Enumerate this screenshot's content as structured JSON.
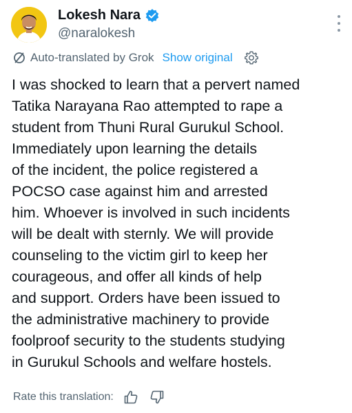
{
  "author": {
    "name": "Lokesh Nara",
    "handle": "@naralokesh",
    "verified": true
  },
  "translation": {
    "label": "Auto-translated by Grok",
    "show_original": "Show original"
  },
  "post": {
    "text": "I was shocked to learn that a pervert named\nTatika Narayana Rao attempted to rape a\nstudent from Thuni Rural Gurukul School.\nImmediately upon learning the details\nof the incident, the police registered a\nPOCSO case against him and arrested\nhim. Whoever is involved in such incidents\nwill be dealt with sternly. We will provide\ncounseling to the victim girl to keep her\ncourageous, and offer all kinds of help\nand support. Orders have been issued to\nthe administrative machinery to provide\nfoolproof security to the students studying\nin Gurukul Schools and welfare hostels."
  },
  "rating": {
    "label": "Rate this translation:"
  },
  "icons": {
    "verified": "verified-badge-icon",
    "translate": "translate-slash-icon",
    "settings": "gear-icon",
    "more": "more-vertical-icon",
    "like": "thumbs-up-icon",
    "dislike": "thumbs-down-icon"
  },
  "colors": {
    "avatar_bg": "#f2c613",
    "link": "#1d9bf0",
    "secondary_text": "#536471",
    "primary_text": "#0f1419"
  }
}
